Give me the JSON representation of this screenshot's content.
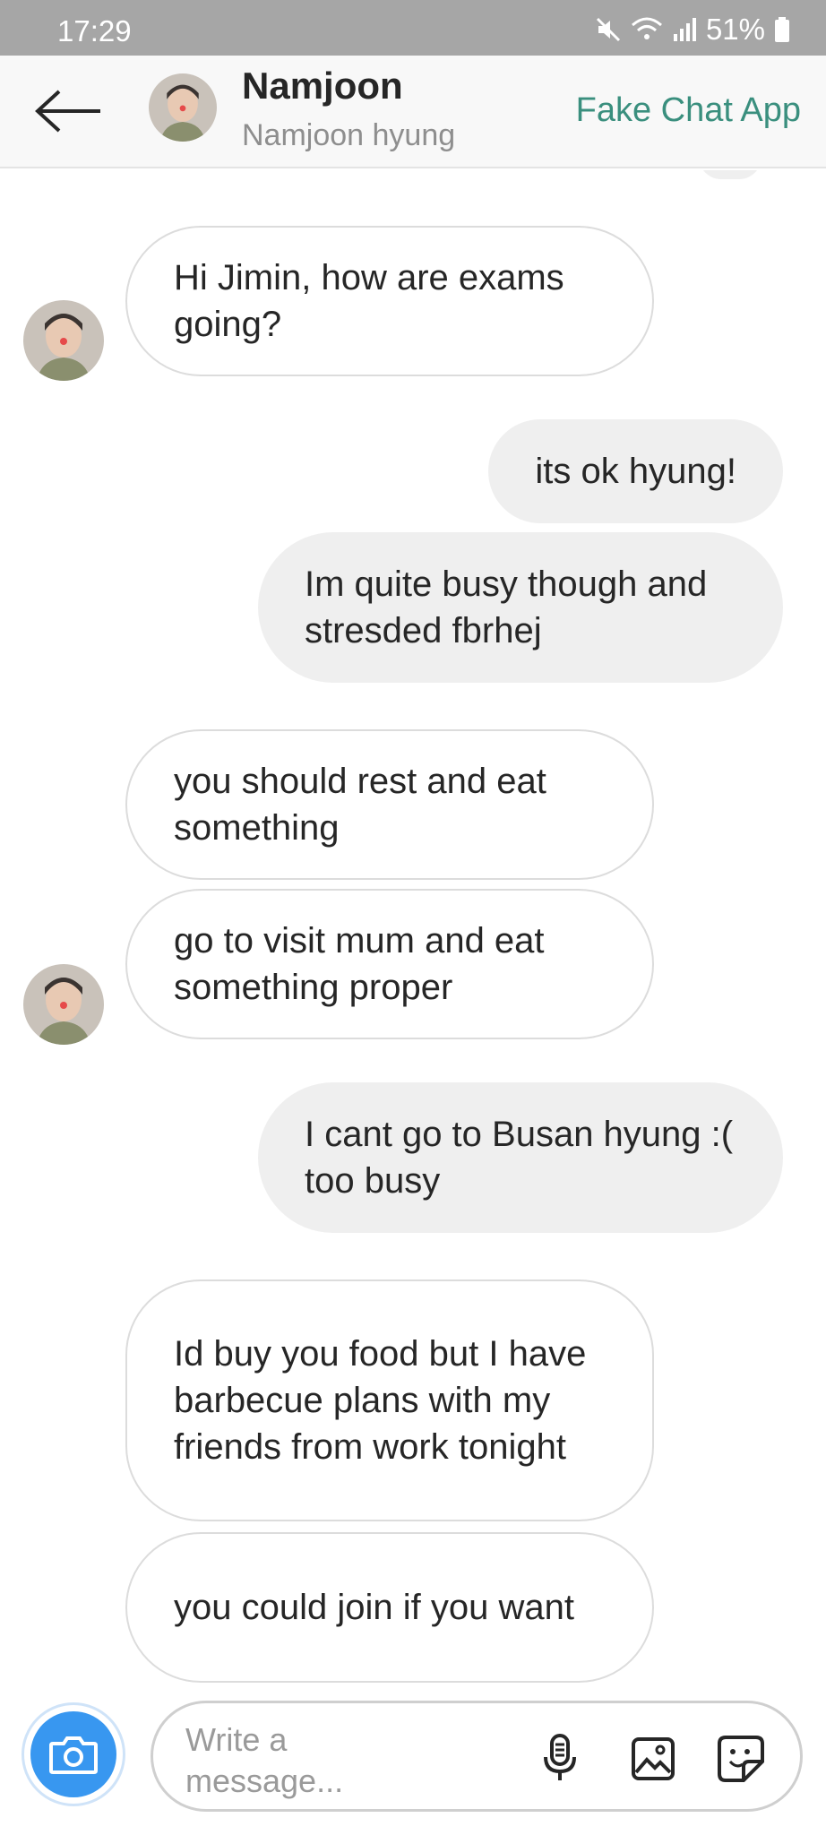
{
  "status_bar": {
    "time": "17:29",
    "battery": "51%",
    "icons": [
      "mute-icon",
      "wifi-icon",
      "signal-icon",
      "battery-icon"
    ]
  },
  "header": {
    "name": "Namjoon",
    "subtitle": "Namjoon hyung",
    "app_label": "Fake Chat App"
  },
  "messages": [
    {
      "from": "them",
      "text": "Hi Jimin, how are exams going?"
    },
    {
      "from": "me",
      "text": "its ok hyung!"
    },
    {
      "from": "me",
      "text": "Im quite busy though and stresded fbrhej"
    },
    {
      "from": "them",
      "text": "you should rest and eat something"
    },
    {
      "from": "them",
      "text": "go to visit mum and eat something proper"
    },
    {
      "from": "me",
      "text": "I cant go to Busan hyung :( too busy"
    },
    {
      "from": "them",
      "text": "Id buy you food but I have barbecue plans with my friends from work tonight"
    },
    {
      "from": "them",
      "text": "you could join if you want"
    }
  ],
  "composer": {
    "placeholder": "Write a message...",
    "icons": [
      "camera-icon",
      "microphone-icon",
      "image-icon",
      "sticker-icon"
    ]
  },
  "colors": {
    "status_bar": "#a6a6a6",
    "accent": "#3a8f7e",
    "camera": "#3897f0",
    "outgoing_bubble": "#efefef"
  }
}
